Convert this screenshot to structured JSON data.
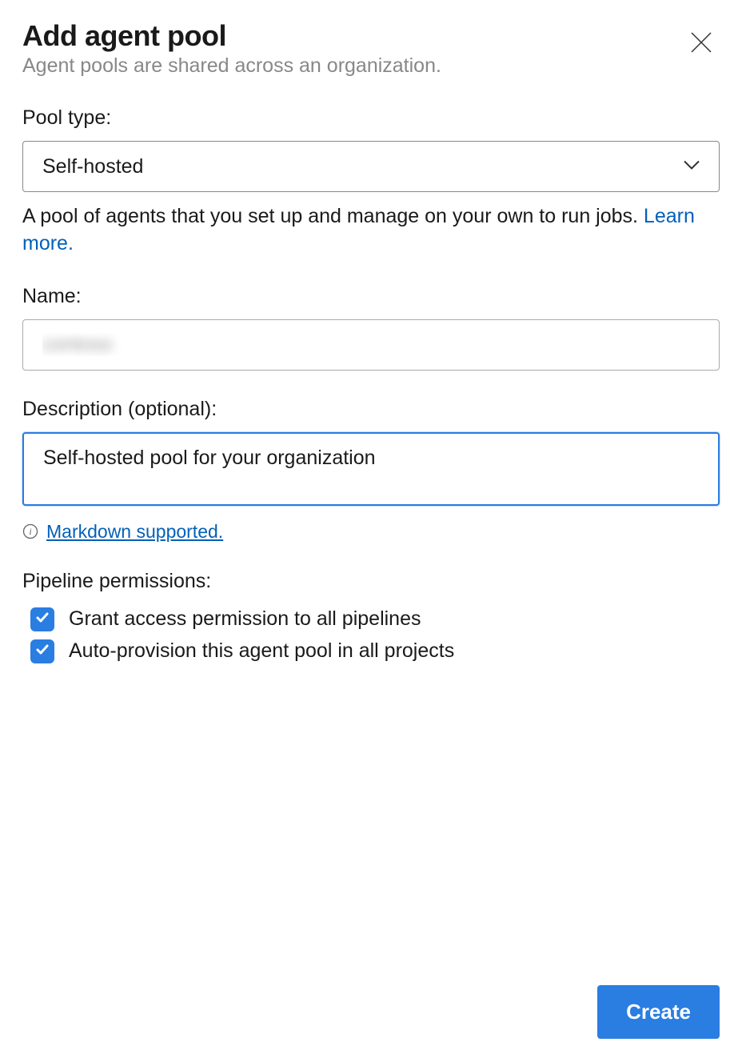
{
  "header": {
    "title": "Add agent pool",
    "subtitle": "Agent pools are shared across an organization."
  },
  "pool_type": {
    "label": "Pool type:",
    "selected": "Self-hosted",
    "help_text": "A pool of agents that you set up and manage on your own to run jobs. ",
    "learn_more": "Learn more."
  },
  "name": {
    "label": "Name:",
    "value": "contoso"
  },
  "description": {
    "label": "Description (optional):",
    "value": "Self-hosted pool for your organization",
    "markdown_note": "Markdown supported."
  },
  "permissions": {
    "label": "Pipeline permissions:",
    "items": [
      {
        "label": "Grant access permission to all pipelines",
        "checked": true
      },
      {
        "label": "Auto-provision this agent pool in all projects",
        "checked": true
      }
    ]
  },
  "footer": {
    "create": "Create"
  }
}
